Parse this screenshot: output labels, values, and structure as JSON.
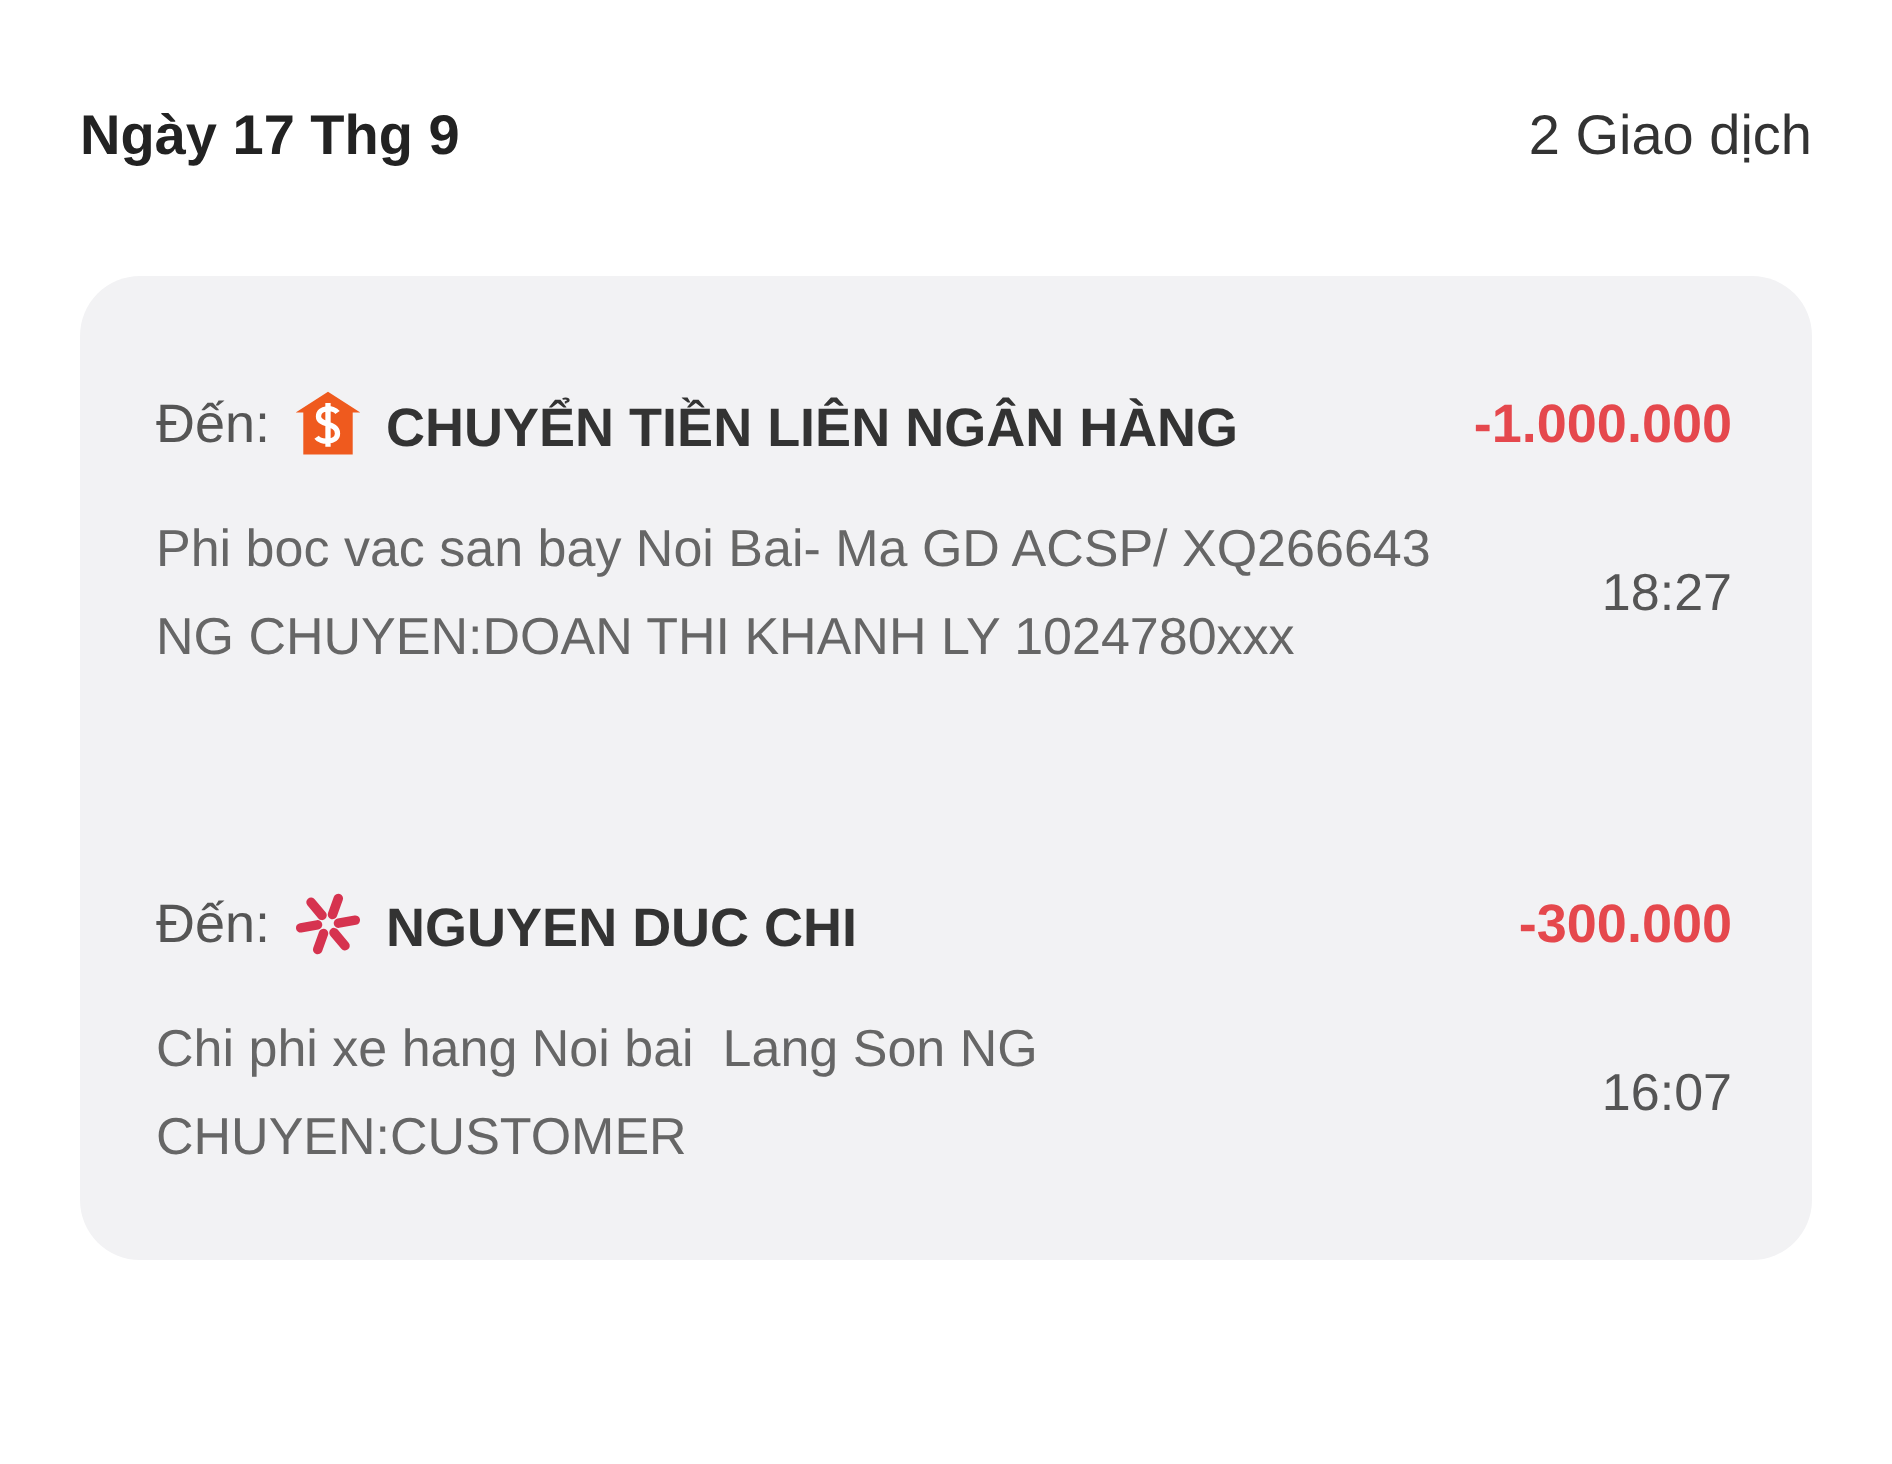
{
  "header": {
    "date": "Ngày 17 Thg 9",
    "count": "2 Giao dịch"
  },
  "transactions": [
    {
      "kind": "bank",
      "to_label": "Đến:",
      "name": "CHUYỂN TIỀN LIÊN NGÂN HÀNG",
      "amount": "-1.000.000",
      "description": "Phi boc vac san bay Noi Bai- Ma GD ACSP/ XQ266643 NG CHUYEN:DOAN THI KHANH LY 1024780xxx",
      "time": "18:27"
    },
    {
      "kind": "star",
      "to_label": "Đến:",
      "name": "NGUYEN DUC CHI",
      "amount": "-300.000",
      "description": "Chi phi xe hang Noi bai  Lang Son NG CHUYEN:CUSTOMER",
      "time": "16:07"
    }
  ]
}
